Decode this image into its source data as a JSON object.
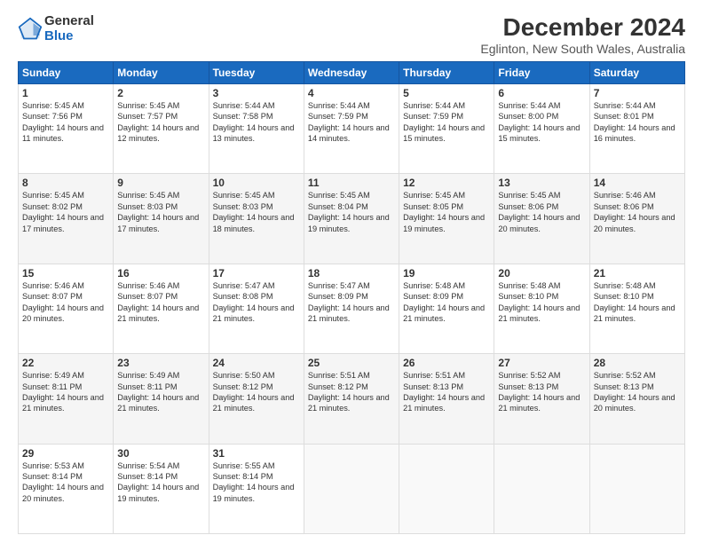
{
  "logo": {
    "general": "General",
    "blue": "Blue"
  },
  "title": "December 2024",
  "subtitle": "Eglinton, New South Wales, Australia",
  "days": [
    "Sunday",
    "Monday",
    "Tuesday",
    "Wednesday",
    "Thursday",
    "Friday",
    "Saturday"
  ],
  "weeks": [
    [
      {
        "day": "1",
        "sunrise": "5:45 AM",
        "sunset": "7:56 PM",
        "daylight": "14 hours and 11 minutes."
      },
      {
        "day": "2",
        "sunrise": "5:45 AM",
        "sunset": "7:57 PM",
        "daylight": "14 hours and 12 minutes."
      },
      {
        "day": "3",
        "sunrise": "5:44 AM",
        "sunset": "7:58 PM",
        "daylight": "14 hours and 13 minutes."
      },
      {
        "day": "4",
        "sunrise": "5:44 AM",
        "sunset": "7:59 PM",
        "daylight": "14 hours and 14 minutes."
      },
      {
        "day": "5",
        "sunrise": "5:44 AM",
        "sunset": "7:59 PM",
        "daylight": "14 hours and 15 minutes."
      },
      {
        "day": "6",
        "sunrise": "5:44 AM",
        "sunset": "8:00 PM",
        "daylight": "14 hours and 15 minutes."
      },
      {
        "day": "7",
        "sunrise": "5:44 AM",
        "sunset": "8:01 PM",
        "daylight": "14 hours and 16 minutes."
      }
    ],
    [
      {
        "day": "8",
        "sunrise": "5:45 AM",
        "sunset": "8:02 PM",
        "daylight": "14 hours and 17 minutes."
      },
      {
        "day": "9",
        "sunrise": "5:45 AM",
        "sunset": "8:03 PM",
        "daylight": "14 hours and 17 minutes."
      },
      {
        "day": "10",
        "sunrise": "5:45 AM",
        "sunset": "8:03 PM",
        "daylight": "14 hours and 18 minutes."
      },
      {
        "day": "11",
        "sunrise": "5:45 AM",
        "sunset": "8:04 PM",
        "daylight": "14 hours and 19 minutes."
      },
      {
        "day": "12",
        "sunrise": "5:45 AM",
        "sunset": "8:05 PM",
        "daylight": "14 hours and 19 minutes."
      },
      {
        "day": "13",
        "sunrise": "5:45 AM",
        "sunset": "8:06 PM",
        "daylight": "14 hours and 20 minutes."
      },
      {
        "day": "14",
        "sunrise": "5:46 AM",
        "sunset": "8:06 PM",
        "daylight": "14 hours and 20 minutes."
      }
    ],
    [
      {
        "day": "15",
        "sunrise": "5:46 AM",
        "sunset": "8:07 PM",
        "daylight": "14 hours and 20 minutes."
      },
      {
        "day": "16",
        "sunrise": "5:46 AM",
        "sunset": "8:07 PM",
        "daylight": "14 hours and 21 minutes."
      },
      {
        "day": "17",
        "sunrise": "5:47 AM",
        "sunset": "8:08 PM",
        "daylight": "14 hours and 21 minutes."
      },
      {
        "day": "18",
        "sunrise": "5:47 AM",
        "sunset": "8:09 PM",
        "daylight": "14 hours and 21 minutes."
      },
      {
        "day": "19",
        "sunrise": "5:48 AM",
        "sunset": "8:09 PM",
        "daylight": "14 hours and 21 minutes."
      },
      {
        "day": "20",
        "sunrise": "5:48 AM",
        "sunset": "8:10 PM",
        "daylight": "14 hours and 21 minutes."
      },
      {
        "day": "21",
        "sunrise": "5:48 AM",
        "sunset": "8:10 PM",
        "daylight": "14 hours and 21 minutes."
      }
    ],
    [
      {
        "day": "22",
        "sunrise": "5:49 AM",
        "sunset": "8:11 PM",
        "daylight": "14 hours and 21 minutes."
      },
      {
        "day": "23",
        "sunrise": "5:49 AM",
        "sunset": "8:11 PM",
        "daylight": "14 hours and 21 minutes."
      },
      {
        "day": "24",
        "sunrise": "5:50 AM",
        "sunset": "8:12 PM",
        "daylight": "14 hours and 21 minutes."
      },
      {
        "day": "25",
        "sunrise": "5:51 AM",
        "sunset": "8:12 PM",
        "daylight": "14 hours and 21 minutes."
      },
      {
        "day": "26",
        "sunrise": "5:51 AM",
        "sunset": "8:13 PM",
        "daylight": "14 hours and 21 minutes."
      },
      {
        "day": "27",
        "sunrise": "5:52 AM",
        "sunset": "8:13 PM",
        "daylight": "14 hours and 21 minutes."
      },
      {
        "day": "28",
        "sunrise": "5:52 AM",
        "sunset": "8:13 PM",
        "daylight": "14 hours and 20 minutes."
      }
    ],
    [
      {
        "day": "29",
        "sunrise": "5:53 AM",
        "sunset": "8:14 PM",
        "daylight": "14 hours and 20 minutes."
      },
      {
        "day": "30",
        "sunrise": "5:54 AM",
        "sunset": "8:14 PM",
        "daylight": "14 hours and 19 minutes."
      },
      {
        "day": "31",
        "sunrise": "5:55 AM",
        "sunset": "8:14 PM",
        "daylight": "14 hours and 19 minutes."
      },
      null,
      null,
      null,
      null
    ]
  ]
}
